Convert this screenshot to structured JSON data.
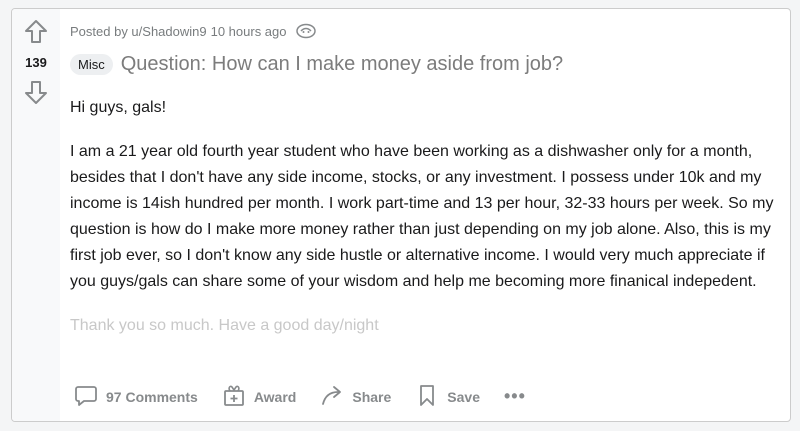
{
  "post": {
    "vote_count": "139",
    "author_line": "Posted by u/Shadowin9",
    "time_ago": "10 hours ago",
    "flair": "Misc",
    "title": "Question: How can I make money aside from job?",
    "body": [
      "Hi guys, gals!",
      "I am a 21 year old fourth year student who have been working as a dishwasher only for a month, besides that I don't have any side income, stocks, or any investment. I possess under 10k and my income is 14ish hundred per month. I work part-time and 13 per hour, 32-33 hours per week. So my question is how do I make more money rather than just depending on my job alone. Also, this is my first job ever, so I don't know any side hustle or alternative income. I would very much appreciate if you guys/gals can share some of your wisdom and help me becoming more finanical indepedent.",
      "Thank you so much. Have a good day/night"
    ]
  },
  "actions": {
    "comments_label": "97 Comments",
    "award_label": "Award",
    "share_label": "Share",
    "save_label": "Save",
    "more_label": "•••"
  },
  "colors": {
    "card_bg": "#ffffff",
    "page_bg": "#f4f5f6",
    "muted_text": "#787c7e",
    "title_text": "#7c7c7c",
    "flair_bg": "#edeff1"
  },
  "icons": {
    "upvote": "arrow-up-icon",
    "downvote": "arrow-down-icon",
    "comments": "comment-bubble-icon",
    "award": "gift-icon",
    "share": "share-arrow-icon",
    "save": "bookmark-icon",
    "more": "ellipsis-icon"
  }
}
